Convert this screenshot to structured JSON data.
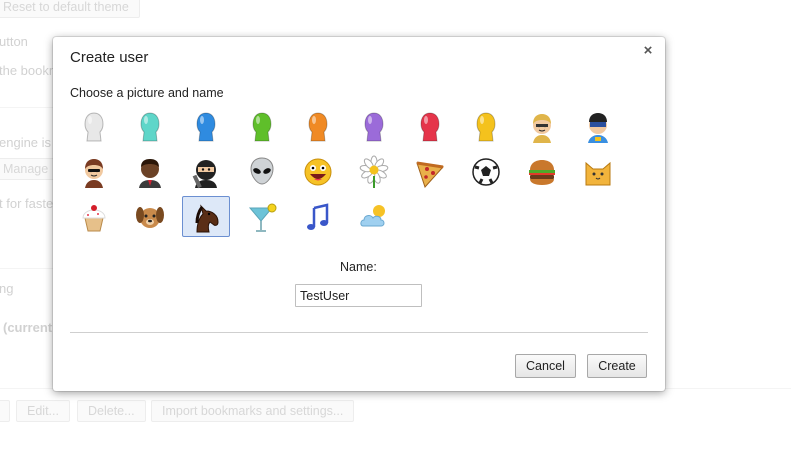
{
  "background": {
    "reset_theme_button": "Reset to default theme",
    "fragments": [
      "utton",
      "the bookm",
      "engine is",
      "t for faste",
      "ng",
      "(current"
    ],
    "manage_button": "Manage",
    "bottom_buttons": [
      "Edit...",
      "Delete...",
      "Import bookmarks and settings..."
    ]
  },
  "dialog": {
    "title": "Create user",
    "close_glyph": "×",
    "subtitle": "Choose a picture and name",
    "name_label": "Name:",
    "name_value": "TestUser",
    "cancel_label": "Cancel",
    "create_label": "Create",
    "avatars": [
      {
        "icon": "avatar-generic-white-icon",
        "color": "#e8e8e8"
      },
      {
        "icon": "avatar-generic-aqua-icon",
        "color": "#5fd6c9"
      },
      {
        "icon": "avatar-generic-blue-icon",
        "color": "#2f8be0"
      },
      {
        "icon": "avatar-generic-green-icon",
        "color": "#5fbf2a"
      },
      {
        "icon": "avatar-generic-orange-icon",
        "color": "#f08a24"
      },
      {
        "icon": "avatar-generic-purple-icon",
        "color": "#9b6bd9"
      },
      {
        "icon": "avatar-generic-red-icon",
        "color": "#e5344a"
      },
      {
        "icon": "avatar-generic-yellow-icon",
        "color": "#f4c21d"
      },
      {
        "icon": "avatar-secret-agent-icon",
        "color": "#e0b54a"
      },
      {
        "icon": "avatar-superhero-icon",
        "color": "#2a4f9e"
      },
      {
        "icon": "avatar-volleyball-girl-icon",
        "color": "#7a3b22"
      },
      {
        "icon": "avatar-businessman-icon",
        "color": "#6b4226"
      },
      {
        "icon": "avatar-ninja-icon",
        "color": "#222222"
      },
      {
        "icon": "avatar-alien-icon",
        "color": "#cfd3d6"
      },
      {
        "icon": "avatar-awesome-smiley-icon",
        "color": "#f6c226"
      },
      {
        "icon": "avatar-flower-icon",
        "color": "#ffffff"
      },
      {
        "icon": "avatar-pizza-icon",
        "color": "#e9b04a"
      },
      {
        "icon": "avatar-soccer-ball-icon",
        "color": "#ffffff"
      },
      {
        "icon": "avatar-burger-icon",
        "color": "#c9782c"
      },
      {
        "icon": "avatar-cat-icon",
        "color": "#f2b43c"
      },
      {
        "icon": "avatar-cupcake-icon",
        "color": "#f7d9b8"
      },
      {
        "icon": "avatar-dog-icon",
        "color": "#c98a4b"
      },
      {
        "icon": "avatar-horse-icon",
        "color": "#5a2e16"
      },
      {
        "icon": "avatar-cocktail-icon",
        "color": "#6cc3d8"
      },
      {
        "icon": "avatar-music-note-icon",
        "color": "#3a57c9"
      },
      {
        "icon": "avatar-sun-cloud-icon",
        "color": "#9fd0f0"
      }
    ],
    "selected_index": 22
  }
}
